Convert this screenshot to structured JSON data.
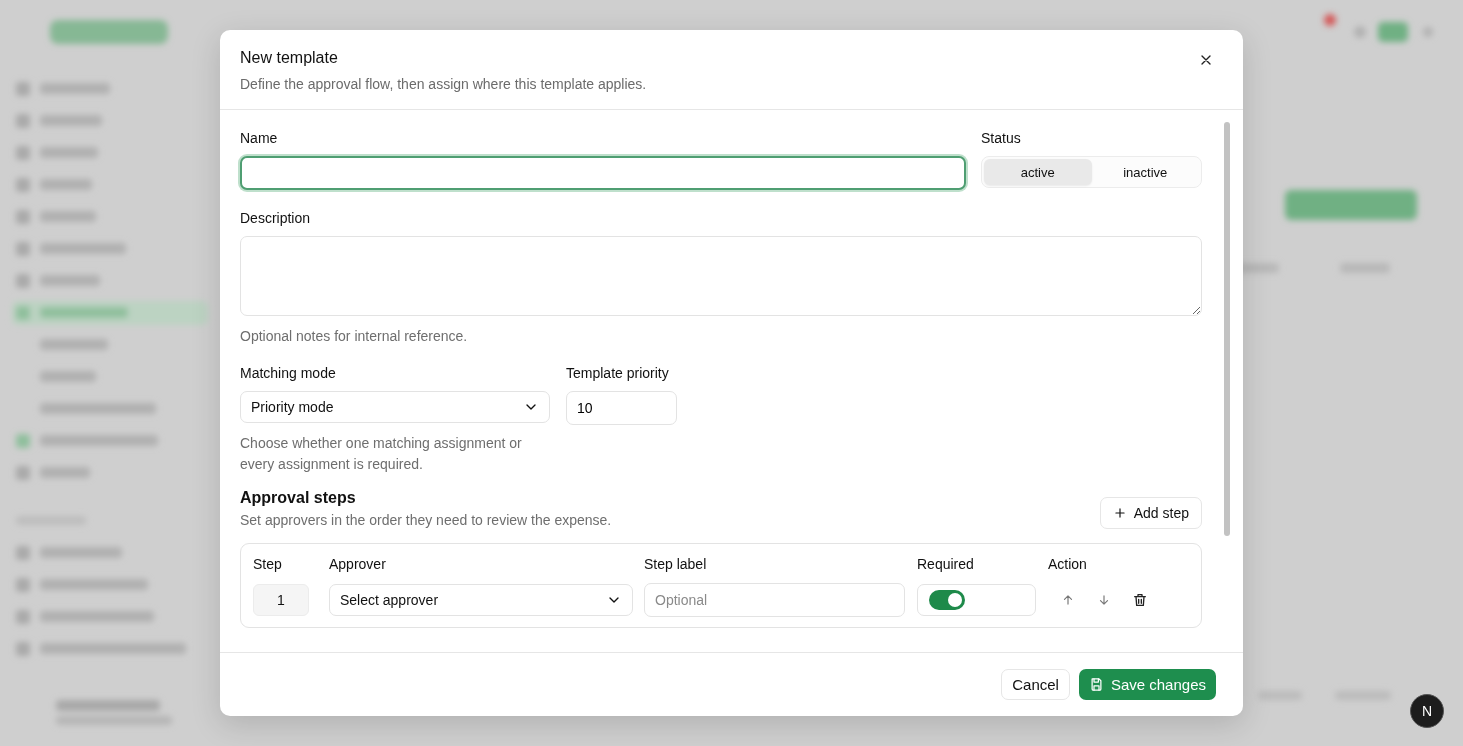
{
  "dialog": {
    "title": "New template",
    "subtitle": "Define the approval flow, then assign where this template applies."
  },
  "name_field": {
    "label": "Name",
    "focused": true
  },
  "status": {
    "label": "Status",
    "options": [
      {
        "label": "active",
        "selected": true
      },
      {
        "label": "inactive",
        "selected": false
      }
    ]
  },
  "description": {
    "label": "Description",
    "hint": "Optional notes for internal reference."
  },
  "matching_mode": {
    "label": "Matching mode",
    "value": "Priority mode",
    "hint": "Choose whether one matching assignment or every assignment is required."
  },
  "template_priority": {
    "label": "Template priority",
    "value": "10"
  },
  "approval_steps": {
    "title": "Approval steps",
    "subtitle": "Set approvers in the order they need to review the expense.",
    "add_button": "Add step",
    "columns": [
      "Step",
      "Approver",
      "Step label",
      "Required",
      "Action"
    ],
    "rows": [
      {
        "step": "1",
        "approver": "Select approver",
        "label_placeholder": "Optional",
        "required": true
      }
    ]
  },
  "footer": {
    "buttons": [
      {
        "label": "Cancel",
        "kind": "secondary"
      },
      {
        "label": "Save changes",
        "kind": "primary"
      }
    ]
  },
  "dev_badge": "N"
}
